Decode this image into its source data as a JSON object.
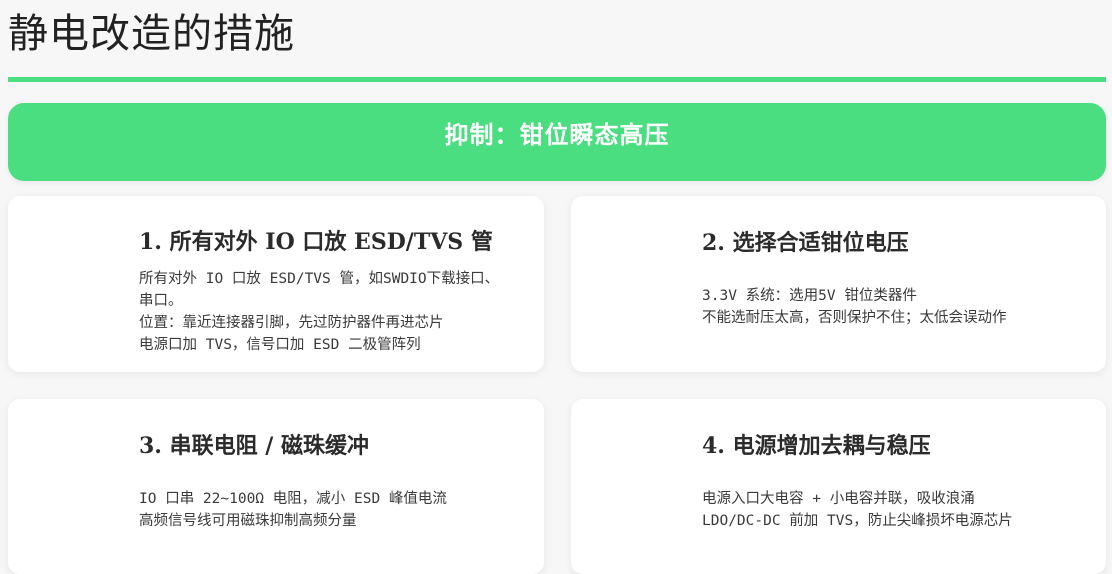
{
  "page": {
    "title": "静电改造的措施"
  },
  "banner": {
    "text": "抑制：钳位瞬态高压"
  },
  "cards": [
    {
      "title": "1. 所有对外 IO 口放 ESD/TVS 管",
      "lines": [
        "所有对外 IO 口放 ESD/TVS 管，如SWDIO下载接口、",
        "串口。",
        "位置：靠近连接器引脚，先过防护器件再进芯片",
        "电源口加 TVS，信号口加 ESD 二极管阵列"
      ]
    },
    {
      "title": "2. 选择合适钳位电压",
      "lines": [
        "3.3V 系统：选用5V 钳位类器件",
        "不能选耐压太高，否则保护不住；太低会误动作"
      ]
    },
    {
      "title": "3. 串联电阻 / 磁珠缓冲",
      "lines": [
        "IO 口串 22~100Ω 电阻，减小 ESD 峰值电流",
        "高频信号线可用磁珠抑制高频分量"
      ]
    },
    {
      "title": "4. 电源增加去耦与稳压",
      "lines": [
        "电源入口大电容 + 小电容并联，吸收浪涌",
        "LDO/DC-DC 前加 TVS，防止尖峰损坏电源芯片"
      ]
    }
  ],
  "colors": {
    "accent": "#4ade80",
    "background": "#f7f7f8",
    "card": "#ffffff",
    "text": "#2b2b2b"
  }
}
